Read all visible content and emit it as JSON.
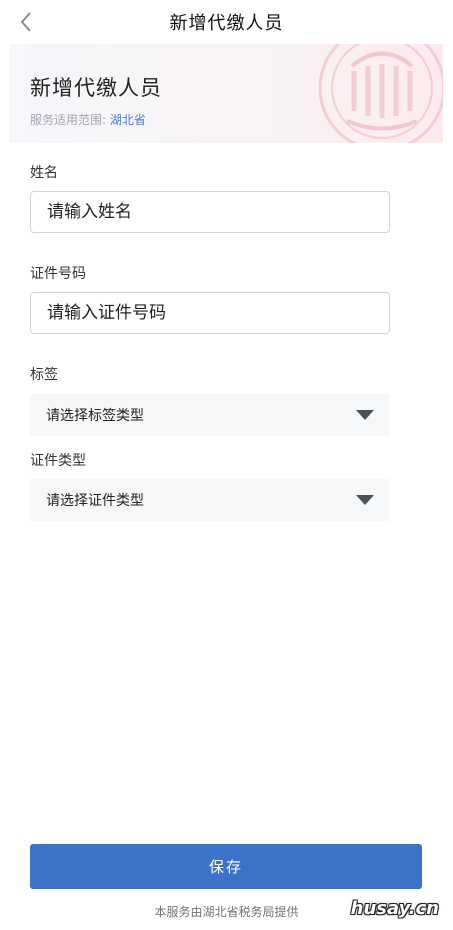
{
  "navbar": {
    "title": "新增代缴人员",
    "back_icon": "chevron-left-icon"
  },
  "banner": {
    "title": "新增代缴人员",
    "scope_label": "服务适用范围: ",
    "scope_province": "湖北省",
    "seal_icon": "emblem-watermark-icon"
  },
  "form": {
    "name": {
      "label": "姓名",
      "placeholder": "请输入姓名"
    },
    "id_number": {
      "label": "证件号码",
      "placeholder": "请输入证件号码"
    },
    "tag": {
      "label": "标签",
      "selected": "请选择标签类型"
    },
    "id_type": {
      "label": "证件类型",
      "selected": "请选择证件类型"
    }
  },
  "actions": {
    "save_label": "保存"
  },
  "footer": {
    "provider_note": "本服务由湖北省税务局提供"
  },
  "watermark": "husay.cn",
  "colors": {
    "primary": "#3c73c8",
    "link": "#4a7bd0"
  }
}
